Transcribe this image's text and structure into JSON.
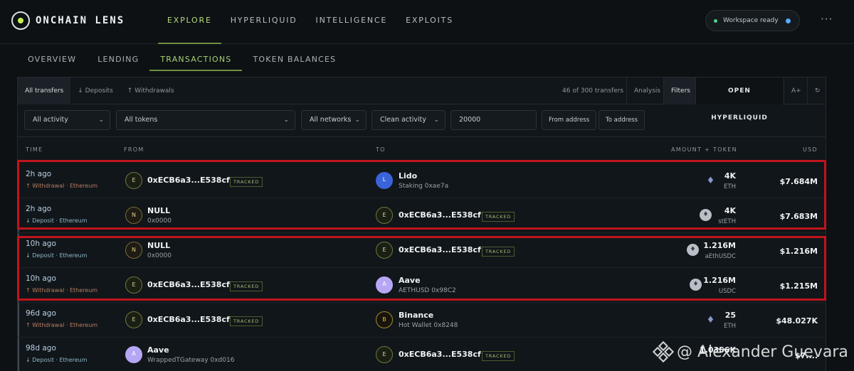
{
  "brand": {
    "name": "ONCHAIN LENS"
  },
  "nav": [
    "EXPLORE",
    "HYPERLIQUID",
    "INTELLIGENCE",
    "EXPLOITS"
  ],
  "status": {
    "label": "Workspace ready"
  },
  "more_label": "···",
  "subtabs": [
    "OVERVIEW",
    "LENDING",
    "TRANSACTIONS",
    "TOKEN BALANCES"
  ],
  "filterbar": {
    "tabs": [
      "All transfers",
      "↓ Deposits",
      "↑ Withdrawals"
    ],
    "count": "46 of 300 transfers",
    "analysis": "Analysis",
    "filters": "Filters",
    "open_hyperliquid": "OPEN HYPERLIQUID",
    "font_size": "A+",
    "refresh": "↻"
  },
  "controls": {
    "activity": "All activity",
    "tokens": "All tokens",
    "networks": "All networks",
    "clean": "Clean activity",
    "min_value": "20000",
    "from_address": "From address",
    "to_address": "To address"
  },
  "columns": {
    "time": "TIME",
    "from": "FROM",
    "to": "TO",
    "amount": "AMOUNT + TOKEN",
    "usd": "USD"
  },
  "rows": [
    {
      "time": "2h ago",
      "direction": "↑ Withdrawal · Ethereum",
      "from_avatar": "E",
      "from_name": "0xECB6a3...E538cf",
      "from_tag": "TRACKED",
      "from_sub": "",
      "to_avatar": "L",
      "to_name": "Lido",
      "to_sub": "Staking 0xae7a",
      "to_tag": "",
      "token_icon": "♦",
      "amount": "4K",
      "token": "ETH",
      "usd": "$7.684M"
    },
    {
      "time": "2h ago",
      "direction": "↓ Deposit · Ethereum",
      "from_avatar": "N",
      "from_name": "NULL",
      "from_tag": "",
      "from_sub": "0x0000",
      "to_avatar": "E",
      "to_name": "0xECB6a3...E538cf",
      "to_sub": "",
      "to_tag": "TRACKED",
      "token_icon": "♦",
      "amount": "4K",
      "token": "stETH",
      "usd": "$7.683M"
    },
    {
      "time": "10h ago",
      "direction": "↓ Deposit · Ethereum",
      "from_avatar": "N",
      "from_name": "NULL",
      "from_tag": "",
      "from_sub": "0x0000",
      "to_avatar": "E",
      "to_name": "0xECB6a3...E538cf",
      "to_sub": "",
      "to_tag": "TRACKED",
      "token_icon": "♦",
      "amount": "1.216M",
      "token": "aEthUSDC",
      "usd": "$1.216M"
    },
    {
      "time": "10h ago",
      "direction": "↑ Withdrawal · Ethereum",
      "from_avatar": "E",
      "from_name": "0xECB6a3...E538cf",
      "from_tag": "TRACKED",
      "from_sub": "",
      "to_avatar": "A",
      "to_name": "Aave",
      "to_sub": "AETHUSD 0x98C2",
      "to_tag": "",
      "token_icon": "♦",
      "amount": "1.216M",
      "token": "USDC",
      "usd": "$1.215M"
    },
    {
      "time": "96d ago",
      "direction": "↑ Withdrawal · Ethereum",
      "from_avatar": "E",
      "from_name": "0xECB6a3...E538cf",
      "from_tag": "TRACKED",
      "from_sub": "",
      "to_avatar": "B",
      "to_name": "Binance",
      "to_sub": "Hot Wallet 0x8248",
      "to_tag": "",
      "token_icon": "♦",
      "amount": "25",
      "token": "ETH",
      "usd": "$48.027K"
    },
    {
      "time": "98d ago",
      "direction": "↓ Deposit · Ethereum",
      "from_avatar": "A",
      "from_name": "Aave",
      "from_tag": "",
      "from_sub": "WrappedTGateway 0xd016",
      "to_avatar": "E",
      "to_name": "0xECB6a3...E538cf",
      "to_sub": "",
      "to_tag": "TRACKED",
      "token_icon": "♦",
      "amount": "1.0356K",
      "token": "",
      "usd": "$7.... "
    }
  ],
  "watermark": "@ Alexander Guevara"
}
